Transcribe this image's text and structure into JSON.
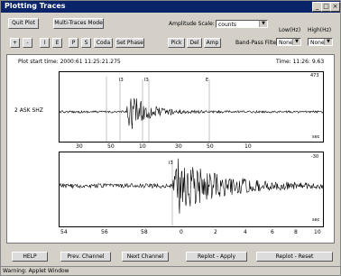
{
  "window": {
    "title": "Plotting Traces"
  },
  "toolbar": {
    "quit_label": "Quit Plot",
    "multi_label": "Multi-Traces Mode",
    "amp_scale_label": "Amplitude Scale:",
    "amp_scale_value": "counts",
    "low_label": "Low(Hz)",
    "high_label": "High(Hz)",
    "bandpass_label": "Band-Pass Filter",
    "low_value": "None",
    "high_value": "None",
    "buttons_row2": [
      "+",
      "-",
      "I",
      "E",
      "P",
      "S",
      "Coda",
      "Set Phase"
    ],
    "pick_label": "Pick",
    "del_label": "Del",
    "amp_label": "Amp"
  },
  "plot": {
    "start_time_label": "Plot start time: 2000:61 11:25:21.275",
    "time_readout": "Time: 11:26: 9.63",
    "channel_label": "2  ASK  SHZ",
    "top_x_ticks": [
      "30",
      "50",
      "10",
      "30",
      "50",
      "10"
    ],
    "top_unit": "sec",
    "top_scale": "473",
    "top_markers": [
      "I3",
      "I3",
      "E"
    ],
    "bottom_x_ticks": [
      "54",
      "56",
      "58",
      "0",
      "2",
      "4",
      "6",
      "8",
      "10"
    ],
    "bottom_unit": "sec",
    "bottom_scale": "-30",
    "bottom_marker": "I3"
  },
  "bottom": {
    "help_label": "HELP",
    "prev_label": "Prev. Channel",
    "next_label": "Next Channel",
    "replot_apply_label": "Replot - Apply",
    "replot_reset_label": "Replot - Reset"
  },
  "status": "Warning: Applet Window"
}
